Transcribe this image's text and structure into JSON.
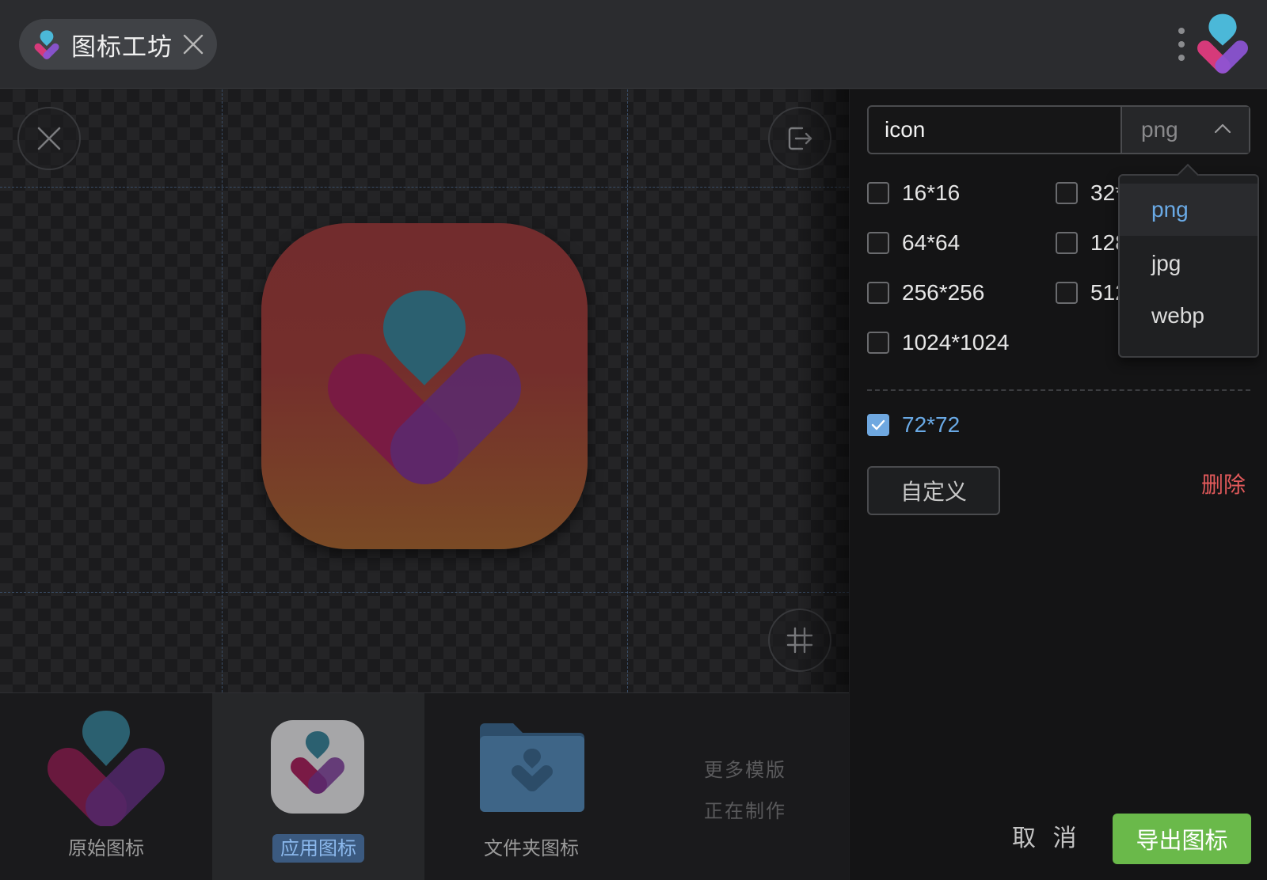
{
  "titlebar": {
    "tab_title": "图标工坊",
    "tab_logo_icon": "app-logo-icon",
    "close_icon": "close-icon",
    "menu_icon": "more-vertical-icon",
    "brand_icon": "brand-logo-icon"
  },
  "canvas": {
    "close_icon": "close-icon",
    "export_icon": "export-icon",
    "grid_icon": "grid-icon"
  },
  "templates": {
    "items": [
      {
        "label": "原始图标",
        "active": false
      },
      {
        "label": "应用图标",
        "active": true
      },
      {
        "label": "文件夹图标",
        "active": false
      }
    ],
    "more_line1": "更多模版",
    "more_line2": "正在制作"
  },
  "panel": {
    "name_value": "icon",
    "format_value": "png",
    "sizes": [
      {
        "label": "16*16",
        "checked": false
      },
      {
        "label": "32*32",
        "checked": false
      },
      {
        "label": "64*64",
        "checked": false
      },
      {
        "label": "128*128",
        "checked": false
      },
      {
        "label": "256*256",
        "checked": false
      },
      {
        "label": "512*512",
        "checked": false
      },
      {
        "label": "1024*1024",
        "checked": false
      }
    ],
    "custom_size": {
      "label": "72*72",
      "checked": true
    },
    "custom_button": "自定义",
    "delete_link": "删除",
    "cancel_button": "取 消",
    "export_button": "导出图标"
  },
  "dropdown": {
    "options": [
      "png",
      "jpg",
      "webp"
    ],
    "selected": "png"
  },
  "colors": {
    "accent": "#6aaae6",
    "export_green": "#6ab94a",
    "danger": "#e0595a",
    "logo_teal": "#4bb8d8",
    "logo_pink": "#d63a7a",
    "logo_purple": "#8d55d6"
  }
}
